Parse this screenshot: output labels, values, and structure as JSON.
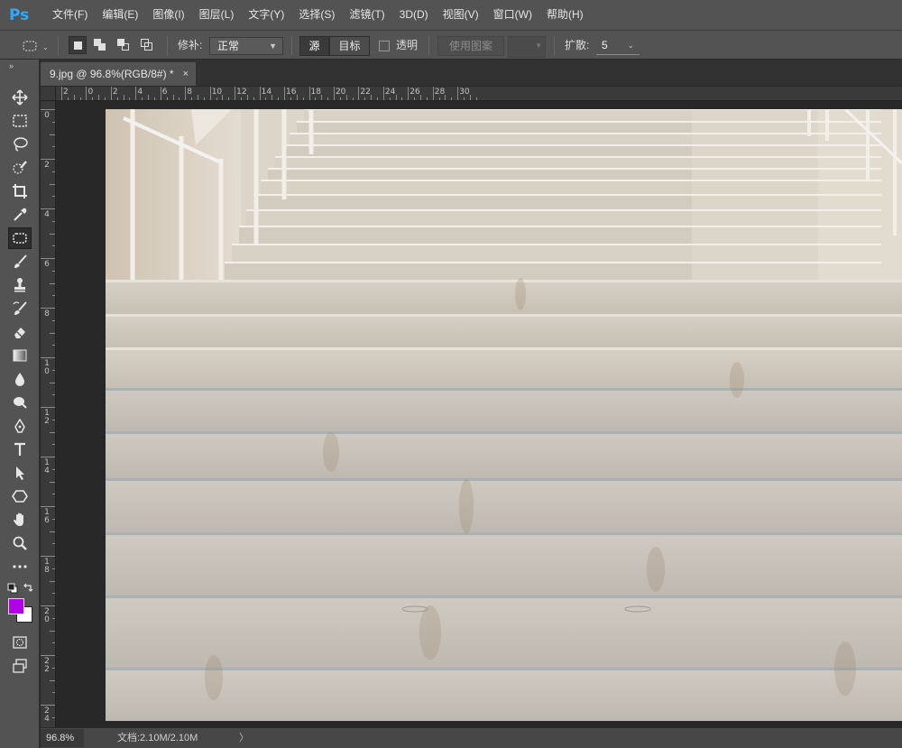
{
  "app": {
    "logo_text": "Ps"
  },
  "menu": [
    "文件(F)",
    "编辑(E)",
    "图像(I)",
    "图层(L)",
    "文字(Y)",
    "选择(S)",
    "滤镜(T)",
    "3D(D)",
    "视图(V)",
    "窗口(W)",
    "帮助(H)"
  ],
  "options": {
    "patch_label": "修补:",
    "patch_mode": "正常",
    "source_label": "源",
    "target_label": "目标",
    "transparent_label": "透明",
    "use_pattern_label": "使用图案",
    "spread_label": "扩散:",
    "spread_value": "5"
  },
  "document": {
    "tab_title": "9.jpg @ 96.8%(RGB/8#) *",
    "tab_close": "×"
  },
  "rulers": {
    "horizontal_labels": [
      "2",
      "0",
      "2",
      "4",
      "6",
      "8",
      "10",
      "12",
      "14",
      "16",
      "18",
      "20",
      "22",
      "24",
      "26",
      "28",
      "30"
    ],
    "vertical_labels": [
      "0",
      "2",
      "4",
      "6",
      "8",
      "10",
      "12",
      "14",
      "16",
      "18",
      "20",
      "22",
      "24"
    ]
  },
  "tools": [
    "move-tool",
    "marquee-tool",
    "lasso-tool",
    "quick-selection-tool",
    "crop-tool",
    "eyedropper-tool",
    "patch-tool",
    "brush-tool",
    "clone-stamp-tool",
    "history-brush-tool",
    "eraser-tool",
    "gradient-tool",
    "blur-tool",
    "dodge-tool",
    "pen-tool",
    "type-tool",
    "path-selection-tool",
    "shape-tool",
    "hand-tool",
    "zoom-tool",
    "more-tools"
  ],
  "colors": {
    "foreground": "#b200e6",
    "background": "#ffffff",
    "accent": "#31a8ff"
  },
  "status": {
    "zoom": "96.8%",
    "doc_info": "文档:2.10M/2.10M",
    "arrow": "〉"
  }
}
